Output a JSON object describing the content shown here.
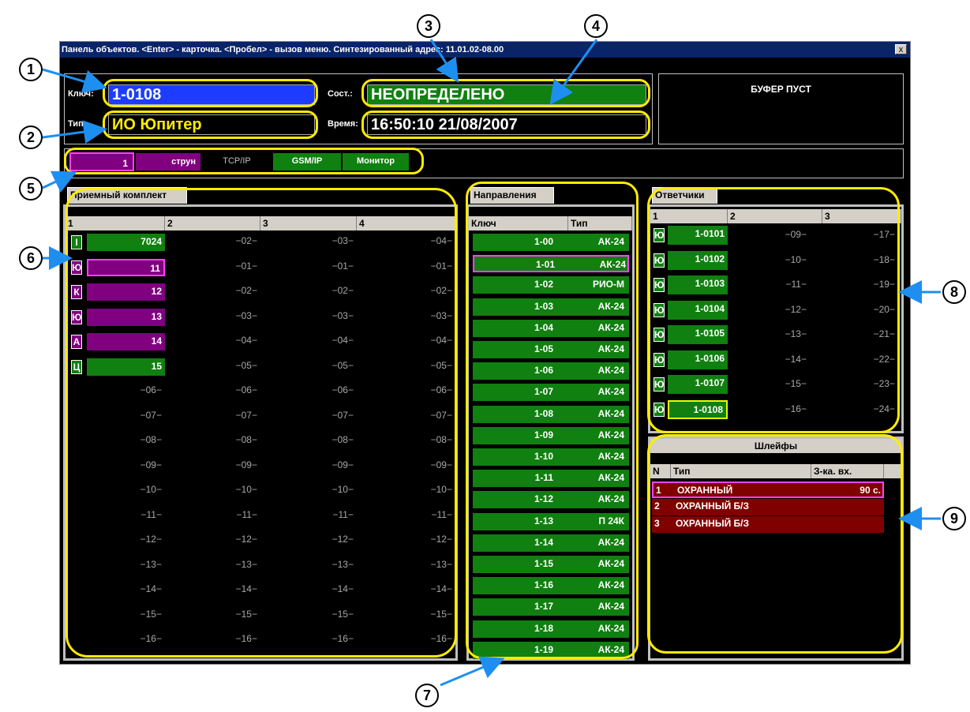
{
  "window": {
    "title": "Панель объектов. <Enter> - карточка. <Пробел> - вызов меню. Синтезированный адрес: 11.01.02-08.00",
    "close": "x"
  },
  "header": {
    "key_label": "Ключ:",
    "key_value": "1-0108",
    "type_label": "Тип:",
    "type_value": "ИО Юпитер",
    "state_label": "Сост.:",
    "state_value": "НЕОПРЕДЕЛЕНО",
    "time_label": "Время:",
    "time_value": "16:50:10 21/08/2007",
    "buffer": "БУФЕР ПУСТ"
  },
  "status": {
    "num": "1",
    "mode": "струн",
    "tcp": "TCP/IP",
    "gsm": "GSM/IP",
    "monitor": "Монитор"
  },
  "receiver": {
    "tab": "Приемный комплект",
    "columns": [
      "1",
      "2",
      "3",
      "4"
    ],
    "rows": [
      {
        "letter": "I",
        "value": "7024",
        "color": "green",
        "c2": "−02−",
        "c3": "−03−",
        "c4": "−04−"
      },
      {
        "letter": "Ю",
        "value": "11",
        "color": "purple",
        "selected": true,
        "c2": "−01−",
        "c3": "−01−",
        "c4": "−01−"
      },
      {
        "letter": "К",
        "value": "12",
        "color": "purple",
        "c2": "−02−",
        "c3": "−02−",
        "c4": "−02−"
      },
      {
        "letter": "Ю",
        "value": "13",
        "color": "purple",
        "c2": "−03−",
        "c3": "−03−",
        "c4": "−03−"
      },
      {
        "letter": "А",
        "value": "14",
        "color": "purple",
        "c2": "−04−",
        "c3": "−04−",
        "c4": "−04−"
      },
      {
        "letter": "Ц",
        "value": "15",
        "color": "green",
        "c2": "−05−",
        "c3": "−05−",
        "c4": "−05−"
      },
      {
        "c1": "−06−",
        "c2": "−06−",
        "c3": "−06−",
        "c4": "−06−"
      },
      {
        "c1": "−07−",
        "c2": "−07−",
        "c3": "−07−",
        "c4": "−07−"
      },
      {
        "c1": "−08−",
        "c2": "−08−",
        "c3": "−08−",
        "c4": "−08−"
      },
      {
        "c1": "−09−",
        "c2": "−09−",
        "c3": "−09−",
        "c4": "−09−"
      },
      {
        "c1": "−10−",
        "c2": "−10−",
        "c3": "−10−",
        "c4": "−10−"
      },
      {
        "c1": "−11−",
        "c2": "−11−",
        "c3": "−11−",
        "c4": "−11−"
      },
      {
        "c1": "−12−",
        "c2": "−12−",
        "c3": "−12−",
        "c4": "−12−"
      },
      {
        "c1": "−13−",
        "c2": "−13−",
        "c3": "−13−",
        "c4": "−13−"
      },
      {
        "c1": "−14−",
        "c2": "−14−",
        "c3": "−14−",
        "c4": "−14−"
      },
      {
        "c1": "−15−",
        "c2": "−15−",
        "c3": "−15−",
        "c4": "−15−"
      },
      {
        "c1": "−16−",
        "c2": "−16−",
        "c3": "−16−",
        "c4": "−16−"
      }
    ]
  },
  "directions": {
    "tab": "Направления",
    "col_key": "Ключ",
    "col_type": "Тип",
    "rows": [
      {
        "key": "1-00",
        "type": "АК-24"
      },
      {
        "key": "1-01",
        "type": "АК-24",
        "selected": true
      },
      {
        "key": "1-02",
        "type": "РИО-М"
      },
      {
        "key": "1-03",
        "type": "АК-24"
      },
      {
        "key": "1-04",
        "type": "АК-24"
      },
      {
        "key": "1-05",
        "type": "АК-24"
      },
      {
        "key": "1-06",
        "type": "АК-24"
      },
      {
        "key": "1-07",
        "type": "АК-24"
      },
      {
        "key": "1-08",
        "type": "АК-24"
      },
      {
        "key": "1-09",
        "type": "АК-24"
      },
      {
        "key": "1-10",
        "type": "АК-24"
      },
      {
        "key": "1-11",
        "type": "АК-24"
      },
      {
        "key": "1-12",
        "type": "АК-24"
      },
      {
        "key": "1-13",
        "type": "П 24К"
      },
      {
        "key": "1-14",
        "type": "АК-24"
      },
      {
        "key": "1-15",
        "type": "АК-24"
      },
      {
        "key": "1-16",
        "type": "АК-24"
      },
      {
        "key": "1-17",
        "type": "АК-24"
      },
      {
        "key": "1-18",
        "type": "АК-24"
      },
      {
        "key": "1-19",
        "type": "АК-24"
      }
    ]
  },
  "responders": {
    "tab": "Ответчики",
    "columns": [
      "1",
      "2",
      "3"
    ],
    "rows": [
      {
        "letter": "Ю",
        "value": "1-0101",
        "c2": "−09−",
        "c3": "−17−"
      },
      {
        "letter": "Ю",
        "value": "1-0102",
        "c2": "−10−",
        "c3": "−18−"
      },
      {
        "letter": "Ю",
        "value": "1-0103",
        "c2": "−11−",
        "c3": "−19−"
      },
      {
        "letter": "Ю",
        "value": "1-0104",
        "c2": "−12−",
        "c3": "−20−"
      },
      {
        "letter": "Ю",
        "value": "1-0105",
        "c2": "−13−",
        "c3": "−21−"
      },
      {
        "letter": "Ю",
        "value": "1-0106",
        "c2": "−14−",
        "c3": "−22−"
      },
      {
        "letter": "Ю",
        "value": "1-0107",
        "c2": "−15−",
        "c3": "−23−"
      },
      {
        "letter": "Ю",
        "value": "1-0108",
        "c2": "−16−",
        "c3": "−24−",
        "selected": true
      }
    ]
  },
  "loops": {
    "title": "Шлейфы",
    "col_n": "N",
    "col_type": "Тип",
    "col_delay": "З-ка. вх.",
    "rows": [
      {
        "n": "1",
        "type": "ОХРАННЫЙ",
        "delay": "90 с.",
        "selected": true
      },
      {
        "n": "2",
        "type": "ОХРАННЫЙ Б/З",
        "delay": ""
      },
      {
        "n": "3",
        "type": "ОХРАННЫЙ Б/З",
        "delay": ""
      }
    ]
  },
  "callouts": [
    "1",
    "2",
    "3",
    "4",
    "5",
    "6",
    "7",
    "8",
    "9"
  ],
  "colors": {
    "green": "#108010",
    "purple": "#800080",
    "blue": "#1e3cff",
    "dark_red": "#800000",
    "yellow": "#ffeb00",
    "title_blue": "#0a246a",
    "magenta": "#ff40ff",
    "lime": "#e0ff00"
  }
}
